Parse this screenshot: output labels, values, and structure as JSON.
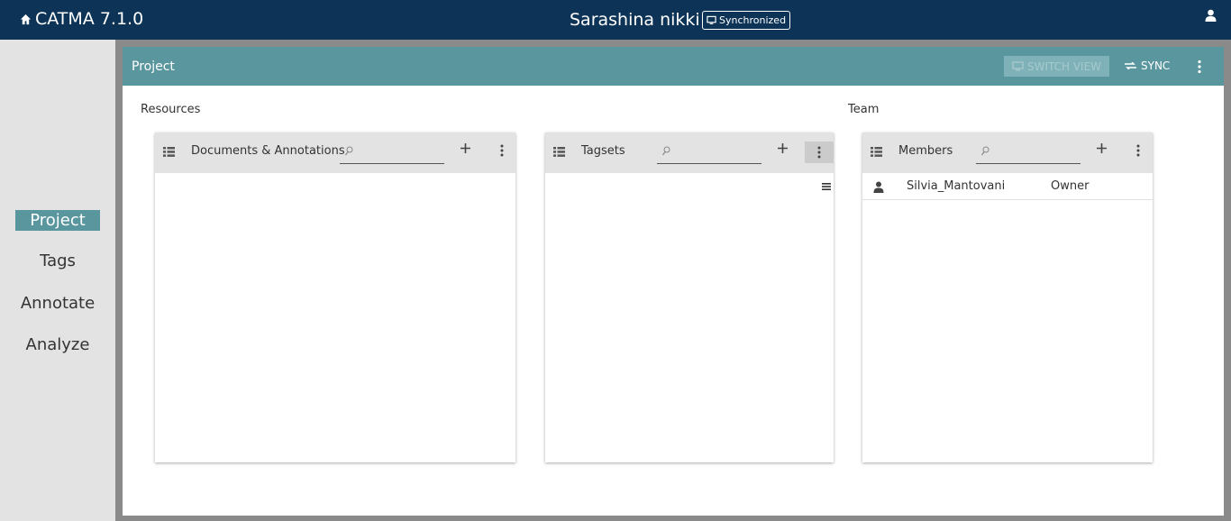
{
  "topbar": {
    "app_name": "CATMA 7.1.0",
    "project_name": "Sarashina nikki",
    "sync_status": "Synchronized"
  },
  "sidebar": {
    "items": [
      {
        "label": "Project",
        "active": true
      },
      {
        "label": "Tags",
        "active": false
      },
      {
        "label": "Annotate",
        "active": false
      },
      {
        "label": "Analyze",
        "active": false
      }
    ]
  },
  "main": {
    "title": "Project",
    "switch_view_label": "SWITCH VIEW",
    "sync_label": "SYNC",
    "resources_label": "Resources",
    "team_label": "Team"
  },
  "panels": {
    "documents": {
      "title": "Documents & Annotations",
      "search_placeholder": ""
    },
    "tagsets": {
      "title": "Tagsets",
      "search_placeholder": ""
    },
    "members": {
      "title": "Members",
      "search_placeholder": ""
    }
  },
  "members": [
    {
      "name": "Silvia_Mantovani",
      "role": "Owner"
    }
  ],
  "colors": {
    "topbar": "#0d3457",
    "accent": "#5a969e",
    "sidebar": "#e3e3e3"
  }
}
